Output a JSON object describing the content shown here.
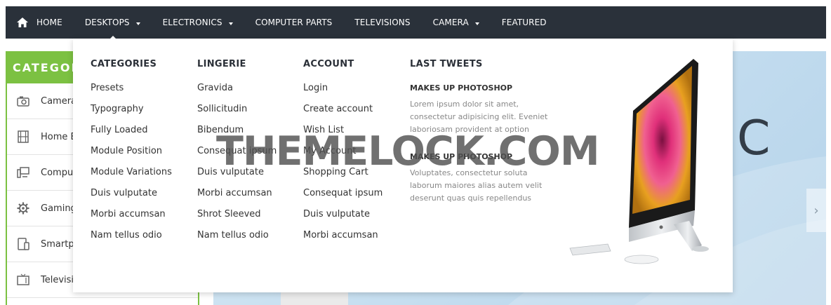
{
  "nav": {
    "items": [
      {
        "label": "HOME",
        "caret": false
      },
      {
        "label": "DESKTOPS",
        "caret": true
      },
      {
        "label": "ELECTRONICS",
        "caret": true
      },
      {
        "label": "COMPUTER PARTS",
        "caret": false
      },
      {
        "label": "TELEVISIONS",
        "caret": false
      },
      {
        "label": "CAMERA",
        "caret": true
      },
      {
        "label": "FEATURED",
        "caret": false
      }
    ]
  },
  "sidebar": {
    "title": "CATEGOR",
    "items": [
      {
        "label": "Camera",
        "icon": "camera-icon"
      },
      {
        "label": "Home E",
        "icon": "film-icon"
      },
      {
        "label": "Comput",
        "icon": "computer-icon"
      },
      {
        "label": "Gaming",
        "icon": "gear-icon"
      },
      {
        "label": "Smartp",
        "icon": "smartphone-icon"
      },
      {
        "label": "Televisi",
        "icon": "tv-icon"
      }
    ]
  },
  "mega_menu": {
    "columns": [
      {
        "title": "CATEGORIES",
        "links": [
          "Presets",
          "Typography",
          "Fully Loaded",
          "Module Position",
          "Module Variations",
          "Duis vulputate",
          "Morbi accumsan",
          "Nam tellus odio"
        ]
      },
      {
        "title": "LINGERIE",
        "links": [
          "Gravida",
          "Sollicitudin",
          "Bibendum",
          "Consequat ipsum",
          "Duis vulputate",
          "Morbi accumsan",
          "Shrot Sleeved",
          "Nam tellus odio"
        ]
      },
      {
        "title": "ACCOUNT",
        "links": [
          "Login",
          "Create account",
          "Wish List",
          "My Account",
          "Shopping Cart",
          "Consequat ipsum",
          "Duis vulputate",
          "Morbi accumsan"
        ]
      }
    ],
    "tweets": {
      "title": "LAST TWEETS",
      "items": [
        {
          "title": "MAKES UP PHOTOSHOP",
          "body": "Lorem ipsum dolor sit amet, consectetur adipisicing elit. Eveniet laboriosam provident at option"
        },
        {
          "title": "MAKES UP PHOTOSHOP",
          "body": "Voluptates, consectetur soluta laborum maiores alias autem velit deserunt quas quis repellendus"
        }
      ]
    }
  },
  "banner": {
    "letter": "C",
    "next_arrow": "›"
  },
  "watermark": "THEMELOCK.COM",
  "colors": {
    "nav_bg": "#2a313a",
    "accent_green": "#7cc142"
  }
}
